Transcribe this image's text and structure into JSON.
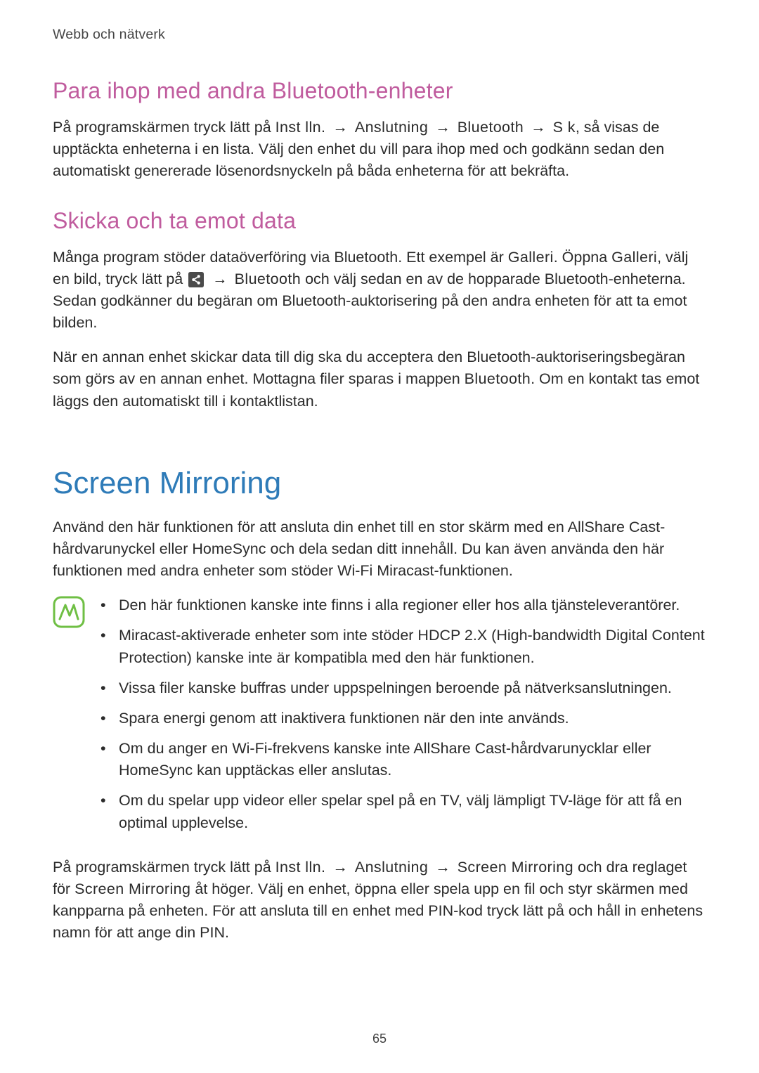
{
  "breadcrumb": "Webb och nätverk",
  "section1": {
    "heading": "Para ihop med andra Bluetooth-enheter",
    "p1_a": "På programskärmen tryck lätt på ",
    "p1_kw1": "Inst lln.",
    "p1_arrow": " → ",
    "p1_kw2": "Anslutning",
    "p1_kw3": "Bluetooth",
    "p1_kw4": "S k",
    "p1_b": ", så visas de upptäckta enheterna i en lista. Välj den enhet du vill para ihop med och godkänn sedan den automatiskt genererade lösenordsnyckeln på båda enheterna för att bekräfta."
  },
  "section2": {
    "heading": "Skicka och ta emot data",
    "p1_a": "Många program stöder dataöverföring via Bluetooth. Ett exempel är ",
    "p1_kw1": "Galleri",
    "p1_b": ". Öppna ",
    "p1_kw2": "Galleri",
    "p1_c": ", välj en bild, tryck lätt på ",
    "p1_arrow": " → ",
    "p1_kw3": "Bluetooth",
    "p1_d": " och välj sedan en av de hopparade Bluetooth-enheterna. Sedan godkänner du begäran om Bluetooth-auktorisering på den andra enheten för att ta emot bilden.",
    "p2_a": "När en annan enhet skickar data till dig ska du acceptera den Bluetooth-auktoriseringsbegäran som görs av en annan enhet. Mottagna filer sparas i mappen ",
    "p2_kw1": "Bluetooth",
    "p2_b": ". Om en kontakt tas emot läggs den automatiskt till i kontaktlistan."
  },
  "section3": {
    "heading": "Screen Mirroring",
    "p1": "Använd den här funktionen för att ansluta din enhet till en stor skärm med en AllShare Cast-hårdvarunyckel eller HomeSync och dela sedan ditt innehåll. Du kan även använda den här funktionen med andra enheter som stöder Wi-Fi Miracast-funktionen.",
    "notes": [
      "Den här funktionen kanske inte finns i alla regioner eller hos alla tjänsteleverantörer.",
      "Miracast-aktiverade enheter som inte stöder HDCP 2.X (High-bandwidth Digital Content Protection) kanske inte är kompatibla med den här funktionen.",
      "Vissa filer kanske buffras under uppspelningen beroende på nätverksanslutningen.",
      "Spara energi genom att inaktivera funktionen när den inte används.",
      "Om du anger en Wi-Fi-frekvens kanske inte AllShare Cast-hårdvarunycklar eller HomeSync kan upptäckas eller anslutas.",
      "Om du spelar upp videor eller spelar spel på en TV, välj lämpligt TV-läge för att få en optimal upplevelse."
    ],
    "p2_a": "På programskärmen tryck lätt på ",
    "p2_kw1": "Inst lln.",
    "p2_arrow": " → ",
    "p2_kw2": "Anslutning",
    "p2_kw3": "Screen Mirroring",
    "p2_b": " och dra reglaget för ",
    "p2_kw4": "Screen Mirroring",
    "p2_c": " åt höger. Välj en enhet, öppna eller spela upp en fil och styr skärmen med kanpparna på enheten. För att ansluta till en enhet med PIN-kod tryck lätt på och håll in enhetens namn för att ange din PIN."
  },
  "page_number": "65"
}
